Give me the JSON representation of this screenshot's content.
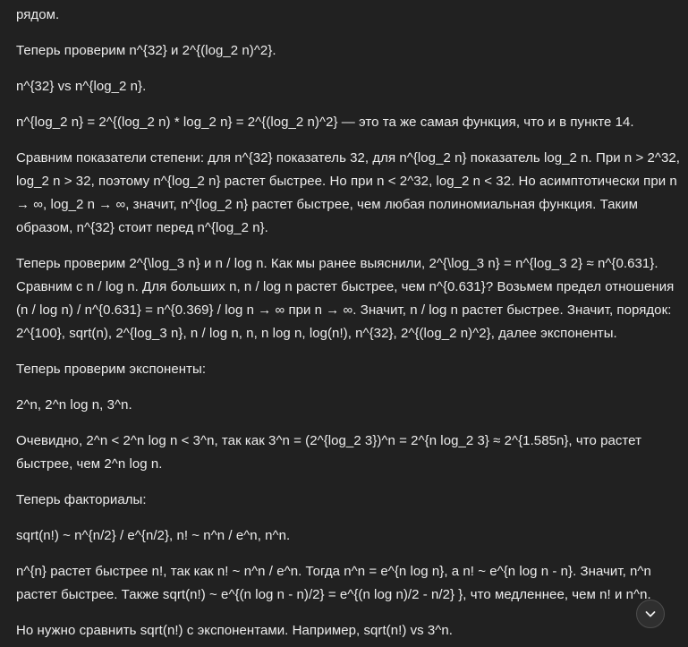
{
  "paragraphs": [
    "рядом.",
    "Теперь проверим n^{32} и 2^{(log_2 n)^2}.",
    "n^{32} vs n^{log_2 n}.",
    "n^{log_2 n} = 2^{(log_2 n) * log_2 n} = 2^{(log_2 n)^2} — это та же самая функция, что и в пункте 14.",
    "Сравним показатели степени: для n^{32} показатель 32, для n^{log_2 n} показатель log_2 n. При n > 2^32, log_2 n > 32, поэтому n^{log_2 n} растет быстрее. Но при n < 2^32, log_2 n < 32. Но асимптотически при n → ∞, log_2 n → ∞, значит, n^{log_2 n} растет быстрее, чем любая полиномиальная функция. Таким образом, n^{32} стоит перед n^{log_2 n}.",
    "Теперь проверим 2^{\\log_3 n} и n / log n. Как мы ранее выяснили, 2^{\\log_3 n} = n^{log_3 2} ≈ n^{0.631}. Сравним с n / log n. Для больших n, n / log n растет быстрее, чем n^{0.631}? Возьмем предел отношения (n / log n) / n^{0.631} = n^{0.369} / log n → ∞ при n → ∞. Значит, n / log n растет быстрее. Значит, порядок: 2^{100}, sqrt(n), 2^{log_3 n}, n / log n, n, n log n, log(n!), n^{32}, 2^{(log_2 n)^2}, далее экспоненты.",
    "Теперь проверим экспоненты:",
    "2^n, 2^n log n, 3^n.",
    "Очевидно, 2^n < 2^n log n < 3^n, так как 3^n = (2^{log_2 3})^n = 2^{n log_2 3} ≈ 2^{1.585n}, что растет быстрее, чем 2^n log n.",
    "Теперь факториалы:",
    "sqrt(n!) ~ n^{n/2} / e^{n/2}, n! ~ n^n / e^n, n^n.",
    "n^{n} растет быстрее n!, так как n! ~ n^n / e^n. Тогда n^n = e^{n log n}, а n! ~ e^{n log n - n}. Значит, n^n растет быстрее. Также sqrt(n!) ~ e^{(n log n - n)/2} = e^{(n log n)/2 - n/2} }, что медленнее, чем n! и n^n.",
    "Но нужно сравнить sqrt(n!) с экспонентами. Например, sqrt(n!) vs 3^n."
  ],
  "icons": {
    "scroll_down": "chevron-down-icon"
  },
  "colors": {
    "background": "#212121",
    "text": "#ececec",
    "button_bg": "#2f2f2f"
  }
}
